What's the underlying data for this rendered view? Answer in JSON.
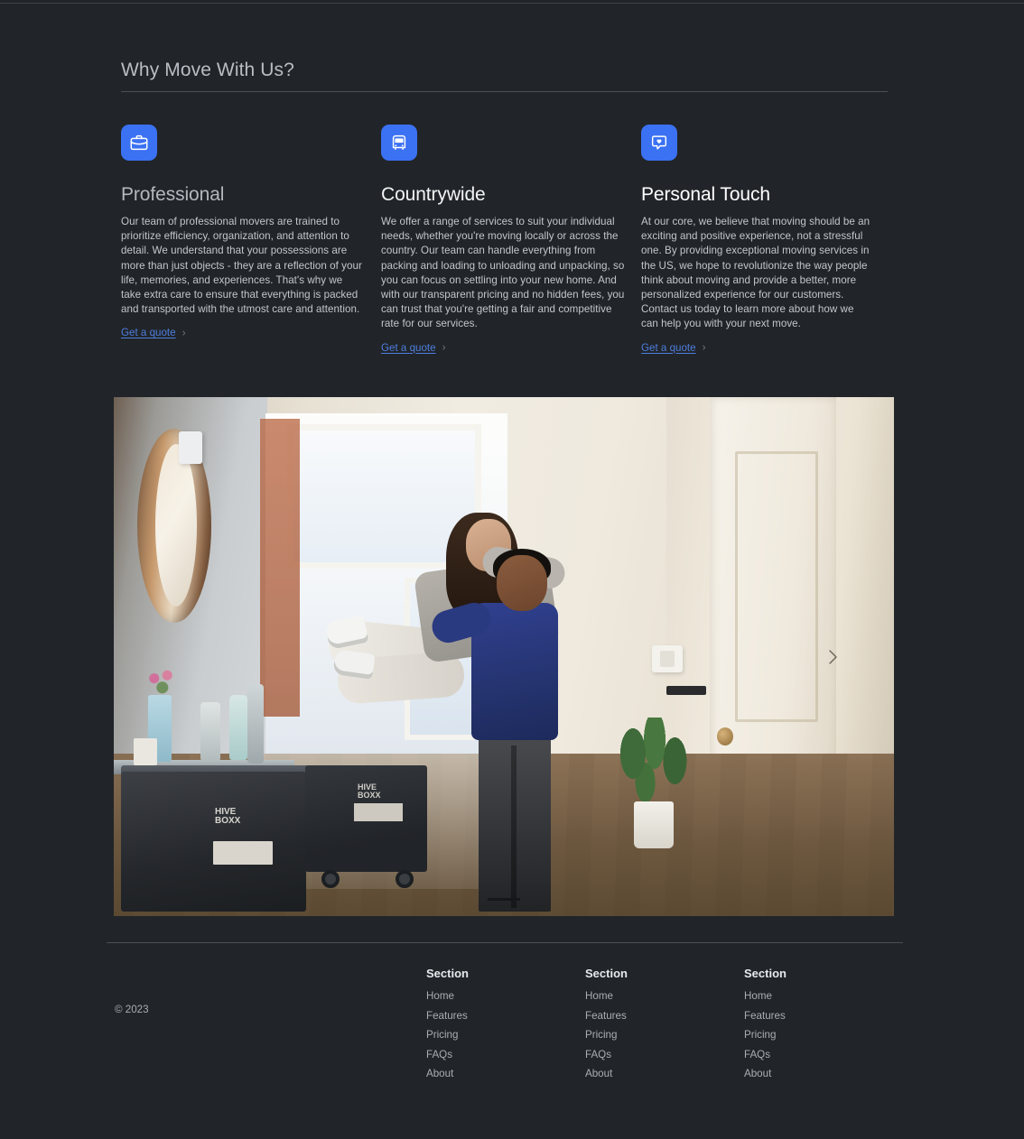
{
  "theme": {
    "background": "#212529",
    "accent_blue": "#3b71f3",
    "link_blue": "#4e7ddd",
    "rule": "#4a5057",
    "body_text": "#c2c7cd"
  },
  "section": {
    "heading": "Why Move With Us?"
  },
  "features": [
    {
      "icon": "briefcase-icon",
      "title": "Professional",
      "body": "Our team of professional movers are trained to prioritize efficiency, organization, and attention to detail. We understand that your possessions are more than just objects - they are a reflection of your life, memories, and experiences. That's why we take extra care to ensure that everything is packed and transported with the utmost care and attention.",
      "link_label": "Get a quote",
      "link_chevron": "›"
    },
    {
      "icon": "bus-icon",
      "title": "Countrywide",
      "body": "We offer a range of services to suit your individual needs, whether you're moving locally or across the country. Our team can handle everything from packing and loading to unloading and unpacking, so you can focus on settling into your new home. And with our transparent pricing and no hidden fees, you can trust that you're getting a fair and competitive rate for our services.",
      "link_label": "Get a quote",
      "link_chevron": "›"
    },
    {
      "icon": "chat-heart-icon",
      "title": "Personal Touch",
      "body": "At our core, we believe that moving should be an exciting and positive experience, not a stressful one. By providing exceptional moving services in the US, we hope to revolutionize the way people think about moving and provide a better, more personalized experience for our customers. Contact us today to learn more about how we can help you with your next move.",
      "link_label": "Get a quote",
      "link_chevron": "›"
    }
  ],
  "carousel": {
    "alt": "Couple embracing joyfully in the hallway of their new home surrounded by moving crates",
    "next_icon": "chevron-right-icon",
    "slides": 1,
    "active_slide": 1
  },
  "footer": {
    "copyright": "© 2023",
    "columns": [
      {
        "title": "Section",
        "links": [
          "Home",
          "Features",
          "Pricing",
          "FAQs",
          "About"
        ]
      },
      {
        "title": "Section",
        "links": [
          "Home",
          "Features",
          "Pricing",
          "FAQs",
          "About"
        ]
      },
      {
        "title": "Section",
        "links": [
          "Home",
          "Features",
          "Pricing",
          "FAQs",
          "About"
        ]
      }
    ]
  }
}
